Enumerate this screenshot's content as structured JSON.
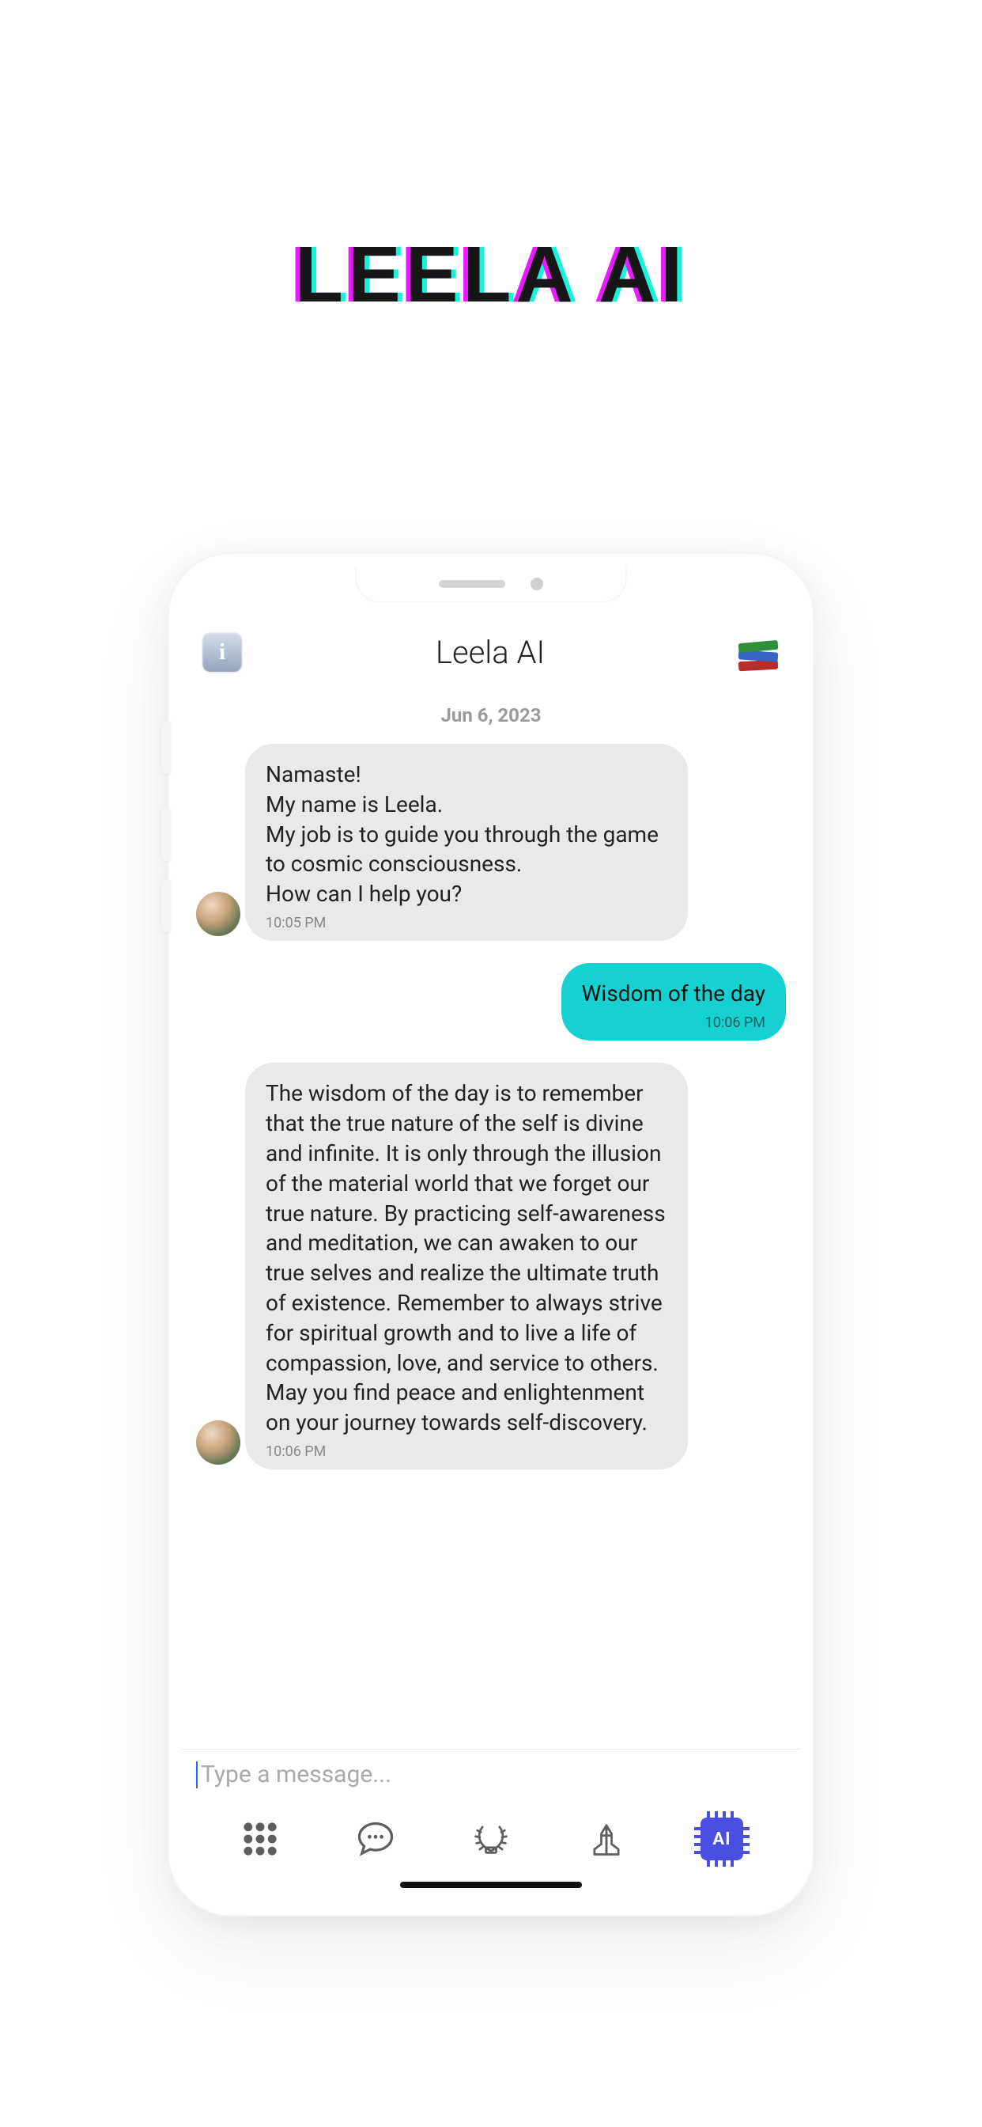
{
  "app_title": "LEELA Ai",
  "header": {
    "title": "Leela AI",
    "info_icon": "ℹ",
    "books_icon": "books-icon"
  },
  "chat": {
    "date": "Jun 6, 2023",
    "messages": [
      {
        "from": "leela",
        "text": "Namaste!\nMy name is Leela.\nMy job is to guide you through the game to cosmic consciousness.\nHow can I help you?",
        "time": "10:05 PM"
      },
      {
        "from": "user",
        "text": "Wisdom of the day",
        "time": "10:06 PM"
      },
      {
        "from": "leela",
        "text": "The wisdom of the day is to remember that the true nature of the self is divine and infinite. It is only through the illusion of the material world that we forget our true nature. By practicing self-awareness and meditation, we can awaken to our true selves and realize the ultimate truth of existence. Remember to always strive for spiritual growth and to live a life of compassion, love, and service to others. May you find peace and enlightenment on your journey towards self-discovery.",
        "time": "10:06 PM"
      }
    ]
  },
  "input": {
    "placeholder": "Type a message..."
  },
  "tabs": {
    "grid": "grid-icon",
    "chat": "chat-bubble-icon",
    "laurel": "laurel-icon",
    "hands": "praying-hands-icon",
    "ai": "ai-chip-icon",
    "ai_label": "AI"
  }
}
